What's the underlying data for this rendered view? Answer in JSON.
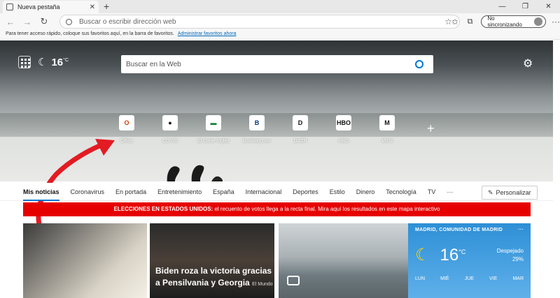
{
  "tab": {
    "title": "Nueva pestaña",
    "close": "✕",
    "new_tab": "+"
  },
  "window": {
    "minimize": "—",
    "maximize": "❐",
    "close": "✕"
  },
  "toolbar": {
    "back": "←",
    "forward": "→",
    "reload": "↻",
    "address_placeholder": "Buscar o escribir dirección web",
    "sync_label": "No sincronizando",
    "more": "···"
  },
  "favbar": {
    "text": "Para tener acceso rápido, coloque sus favoritos aquí, en la barra de favoritos.",
    "link": "Administrar favoritos ahora"
  },
  "hero": {
    "temperature": "16",
    "temp_unit": "°C",
    "search_placeholder": "Buscar en la Web",
    "tiles": [
      {
        "label": "Office",
        "glyph": "O",
        "color": "#d83b01"
      },
      {
        "label": "COVID",
        "glyph": "●",
        "color": "#111111"
      },
      {
        "label": "El Corte Inglés",
        "glyph": "▬",
        "color": "#1a7f37"
      },
      {
        "label": "Booking.com",
        "glyph": "B",
        "color": "#003580"
      },
      {
        "label": "DAZN",
        "glyph": "D",
        "color": "#111111"
      },
      {
        "label": "HBO",
        "glyph": "HBO",
        "color": "#111111"
      },
      {
        "label": "MSN",
        "glyph": "M",
        "color": "#111111"
      }
    ],
    "add": "+"
  },
  "news_nav": {
    "items": [
      "Mis noticias",
      "Coronavirus",
      "En portada",
      "Entretenimiento",
      "España",
      "Internacional",
      "Deportes",
      "Estilo",
      "Dinero",
      "Tecnología",
      "TV",
      "···"
    ],
    "personalize": "Personalizar"
  },
  "banner": {
    "bold": "ELECCIONES EN ESTADOS UNIDOS:",
    "text": " el recuento de votos llega a la recta final. Mira aquí los resultados en este mapa interactivo",
    "color": "#e60000"
  },
  "cards": {
    "headline": "Biden roza la victoria gracias a Pensilvania y Georgia",
    "source": "El Mundo"
  },
  "weather": {
    "location": "MADRID, COMUNIDAD DE MADRID",
    "more": "···",
    "temp": "16",
    "unit": "°C",
    "condition": "Despejado",
    "rain": "29%",
    "days": [
      "LUN",
      "MIÉ",
      "JUE",
      "VIE",
      "MAR"
    ]
  }
}
